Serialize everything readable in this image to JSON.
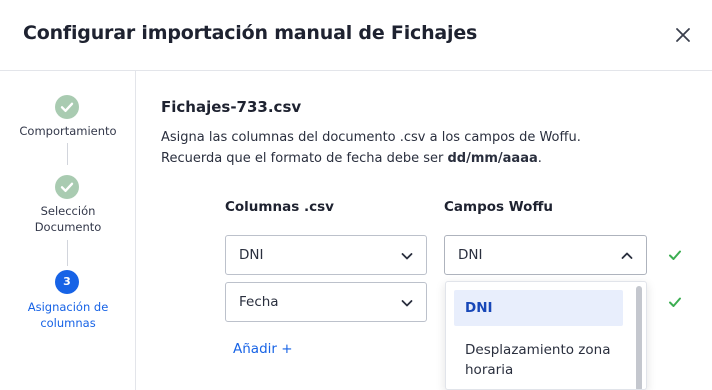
{
  "dialog": {
    "title": "Configurar importación manual de Fichajes",
    "close_icon": "close-icon"
  },
  "stepper": {
    "steps": [
      {
        "label": "Comportamiento",
        "state": "done"
      },
      {
        "label": "Selección Documento",
        "label_lines": [
          "Selección",
          "Documento"
        ],
        "state": "done"
      },
      {
        "label": "Asignación de columnas",
        "label_lines": [
          "Asignación de",
          "columnas"
        ],
        "state": "active",
        "number": "3"
      }
    ]
  },
  "main": {
    "file_name": "Fichajes-733.csv",
    "description_line1": "Asigna las columnas del documento .csv a los campos de Woffu.",
    "description_line2_prefix": "Recuerda que el formato de fecha debe ser ",
    "description_line2_bold": "dd/mm/aaaa",
    "description_line2_suffix": ".",
    "columns_header": "Columnas .csv",
    "fields_header": "Campos Woffu",
    "rows": [
      {
        "csv_column": "DNI",
        "woffu_field": "DNI",
        "valid": true
      },
      {
        "csv_column": "Fecha",
        "woffu_field": "",
        "valid": true
      }
    ],
    "add_link": "Añadir +",
    "dropdown": {
      "open": true,
      "options": [
        {
          "label": "DNI",
          "selected": true
        },
        {
          "label_lines": [
            "Desplazamiento zona",
            "horaria"
          ],
          "label": "Desplazamiento zona horaria",
          "selected": false
        }
      ]
    }
  },
  "colors": {
    "accent": "#1763e6",
    "done_step": "#a9cbb1",
    "check_green": "#3cae52",
    "selected_option_bg": "#e8eefc"
  }
}
